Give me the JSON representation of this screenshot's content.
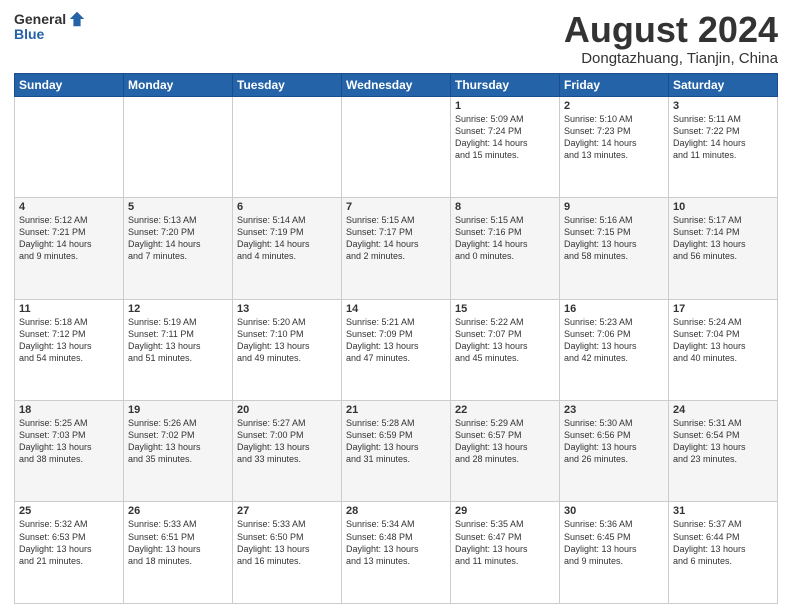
{
  "header": {
    "logo_general": "General",
    "logo_blue": "Blue",
    "month_title": "August 2024",
    "location": "Dongtazhuang, Tianjin, China"
  },
  "days_of_week": [
    "Sunday",
    "Monday",
    "Tuesday",
    "Wednesday",
    "Thursday",
    "Friday",
    "Saturday"
  ],
  "weeks": [
    [
      {
        "day": "",
        "content": ""
      },
      {
        "day": "",
        "content": ""
      },
      {
        "day": "",
        "content": ""
      },
      {
        "day": "",
        "content": ""
      },
      {
        "day": "1",
        "content": "Sunrise: 5:09 AM\nSunset: 7:24 PM\nDaylight: 14 hours\nand 15 minutes."
      },
      {
        "day": "2",
        "content": "Sunrise: 5:10 AM\nSunset: 7:23 PM\nDaylight: 14 hours\nand 13 minutes."
      },
      {
        "day": "3",
        "content": "Sunrise: 5:11 AM\nSunset: 7:22 PM\nDaylight: 14 hours\nand 11 minutes."
      }
    ],
    [
      {
        "day": "4",
        "content": "Sunrise: 5:12 AM\nSunset: 7:21 PM\nDaylight: 14 hours\nand 9 minutes."
      },
      {
        "day": "5",
        "content": "Sunrise: 5:13 AM\nSunset: 7:20 PM\nDaylight: 14 hours\nand 7 minutes."
      },
      {
        "day": "6",
        "content": "Sunrise: 5:14 AM\nSunset: 7:19 PM\nDaylight: 14 hours\nand 4 minutes."
      },
      {
        "day": "7",
        "content": "Sunrise: 5:15 AM\nSunset: 7:17 PM\nDaylight: 14 hours\nand 2 minutes."
      },
      {
        "day": "8",
        "content": "Sunrise: 5:15 AM\nSunset: 7:16 PM\nDaylight: 14 hours\nand 0 minutes."
      },
      {
        "day": "9",
        "content": "Sunrise: 5:16 AM\nSunset: 7:15 PM\nDaylight: 13 hours\nand 58 minutes."
      },
      {
        "day": "10",
        "content": "Sunrise: 5:17 AM\nSunset: 7:14 PM\nDaylight: 13 hours\nand 56 minutes."
      }
    ],
    [
      {
        "day": "11",
        "content": "Sunrise: 5:18 AM\nSunset: 7:12 PM\nDaylight: 13 hours\nand 54 minutes."
      },
      {
        "day": "12",
        "content": "Sunrise: 5:19 AM\nSunset: 7:11 PM\nDaylight: 13 hours\nand 51 minutes."
      },
      {
        "day": "13",
        "content": "Sunrise: 5:20 AM\nSunset: 7:10 PM\nDaylight: 13 hours\nand 49 minutes."
      },
      {
        "day": "14",
        "content": "Sunrise: 5:21 AM\nSunset: 7:09 PM\nDaylight: 13 hours\nand 47 minutes."
      },
      {
        "day": "15",
        "content": "Sunrise: 5:22 AM\nSunset: 7:07 PM\nDaylight: 13 hours\nand 45 minutes."
      },
      {
        "day": "16",
        "content": "Sunrise: 5:23 AM\nSunset: 7:06 PM\nDaylight: 13 hours\nand 42 minutes."
      },
      {
        "day": "17",
        "content": "Sunrise: 5:24 AM\nSunset: 7:04 PM\nDaylight: 13 hours\nand 40 minutes."
      }
    ],
    [
      {
        "day": "18",
        "content": "Sunrise: 5:25 AM\nSunset: 7:03 PM\nDaylight: 13 hours\nand 38 minutes."
      },
      {
        "day": "19",
        "content": "Sunrise: 5:26 AM\nSunset: 7:02 PM\nDaylight: 13 hours\nand 35 minutes."
      },
      {
        "day": "20",
        "content": "Sunrise: 5:27 AM\nSunset: 7:00 PM\nDaylight: 13 hours\nand 33 minutes."
      },
      {
        "day": "21",
        "content": "Sunrise: 5:28 AM\nSunset: 6:59 PM\nDaylight: 13 hours\nand 31 minutes."
      },
      {
        "day": "22",
        "content": "Sunrise: 5:29 AM\nSunset: 6:57 PM\nDaylight: 13 hours\nand 28 minutes."
      },
      {
        "day": "23",
        "content": "Sunrise: 5:30 AM\nSunset: 6:56 PM\nDaylight: 13 hours\nand 26 minutes."
      },
      {
        "day": "24",
        "content": "Sunrise: 5:31 AM\nSunset: 6:54 PM\nDaylight: 13 hours\nand 23 minutes."
      }
    ],
    [
      {
        "day": "25",
        "content": "Sunrise: 5:32 AM\nSunset: 6:53 PM\nDaylight: 13 hours\nand 21 minutes."
      },
      {
        "day": "26",
        "content": "Sunrise: 5:33 AM\nSunset: 6:51 PM\nDaylight: 13 hours\nand 18 minutes."
      },
      {
        "day": "27",
        "content": "Sunrise: 5:33 AM\nSunset: 6:50 PM\nDaylight: 13 hours\nand 16 minutes."
      },
      {
        "day": "28",
        "content": "Sunrise: 5:34 AM\nSunset: 6:48 PM\nDaylight: 13 hours\nand 13 minutes."
      },
      {
        "day": "29",
        "content": "Sunrise: 5:35 AM\nSunset: 6:47 PM\nDaylight: 13 hours\nand 11 minutes."
      },
      {
        "day": "30",
        "content": "Sunrise: 5:36 AM\nSunset: 6:45 PM\nDaylight: 13 hours\nand 9 minutes."
      },
      {
        "day": "31",
        "content": "Sunrise: 5:37 AM\nSunset: 6:44 PM\nDaylight: 13 hours\nand 6 minutes."
      }
    ]
  ]
}
